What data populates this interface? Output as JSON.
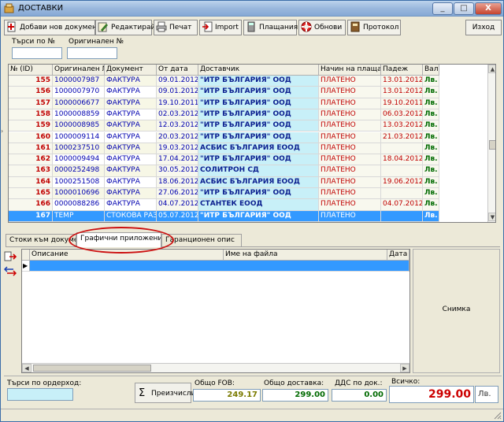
{
  "window": {
    "title": "ДОСТАВКИ",
    "min": "_",
    "max": "□",
    "close": "X"
  },
  "toolbar": {
    "add": "Добави нов документ",
    "edit": "Редактирай",
    "print": "Печат",
    "import": "Import",
    "payments": "Плащания",
    "refresh": "Обнови",
    "protocol": "Протокол",
    "exit": "Изход"
  },
  "search": {
    "by_number_label": "Търси по №",
    "by_original_label": "Оригинален №",
    "by_number_value": "",
    "by_original_value": ""
  },
  "grid": {
    "columns": [
      "№ (ID)",
      "Оригинален №",
      "Документ",
      "От дата",
      "Доставчик",
      "Начин на плащане",
      "Падеж",
      "Вал."
    ],
    "rows": [
      {
        "id": "155",
        "orig": "1000007987",
        "doc": "ФАКТУРА",
        "date": "09.01.2012",
        "supplier": "\"ИТР БЪЛГАРИЯ\" ООД",
        "pay": "ПЛАТЕНО",
        "due": "13.01.2012",
        "cur": "Лв."
      },
      {
        "id": "156",
        "orig": "1000007970",
        "doc": "ФАКТУРА",
        "date": "09.01.2012",
        "supplier": "\"ИТР БЪЛГАРИЯ\" ООД",
        "pay": "ПЛАТЕНО",
        "due": "13.01.2012",
        "cur": "Лв."
      },
      {
        "id": "157",
        "orig": "1000006677",
        "doc": "ФАКТУРА",
        "date": "19.10.2011",
        "supplier": "\"ИТР БЪЛГАРИЯ\" ООД",
        "pay": "ПЛАТЕНО",
        "due": "19.10.2011",
        "cur": "Лв."
      },
      {
        "id": "158",
        "orig": "1000008859",
        "doc": "ФАКТУРА",
        "date": "02.03.2012",
        "supplier": "\"ИТР БЪЛГАРИЯ\" ООД",
        "pay": "ПЛАТЕНО",
        "due": "06.03.2012",
        "cur": "Лв."
      },
      {
        "id": "159",
        "orig": "1000008985",
        "doc": "ФАКТУРА",
        "date": "12.03.2012",
        "supplier": "\"ИТР БЪЛГАРИЯ\" ООД",
        "pay": "ПЛАТЕНО",
        "due": "13.03.2012",
        "cur": "Лв."
      },
      {
        "id": "160",
        "orig": "1000009114",
        "doc": "ФАКТУРА",
        "date": "20.03.2012",
        "supplier": "\"ИТР БЪЛГАРИЯ\" ООД",
        "pay": "ПЛАТЕНО",
        "due": "21.03.2012",
        "cur": "Лв."
      },
      {
        "id": "161",
        "orig": "1000237510",
        "doc": "ФАКТУРА",
        "date": "19.03.2012",
        "supplier": "АСБИС БЪЛГАРИЯ ЕООД",
        "pay": "ПЛАТЕНО",
        "due": "",
        "cur": "Лв."
      },
      {
        "id": "162",
        "orig": "1000009494",
        "doc": "ФАКТУРА",
        "date": "17.04.2012",
        "supplier": "\"ИТР БЪЛГАРИЯ\" ООД",
        "pay": "ПЛАТЕНО",
        "due": "18.04.2012",
        "cur": "Лв."
      },
      {
        "id": "163",
        "orig": "0000252498",
        "doc": "ФАКТУРА",
        "date": "30.05.2012",
        "supplier": "СОЛИТРОН СД",
        "pay": "ПЛАТЕНО",
        "due": "",
        "cur": "Лв."
      },
      {
        "id": "164",
        "orig": "1000251508",
        "doc": "ФАКТУРА",
        "date": "18.06.2012",
        "supplier": "АСБИС БЪЛГАРИЯ ЕООД",
        "pay": "ПЛАТЕНО",
        "due": "19.06.2012",
        "cur": "Лв."
      },
      {
        "id": "165",
        "orig": "1000010696",
        "doc": "ФАКТУРА",
        "date": "27.06.2012",
        "supplier": "\"ИТР БЪЛГАРИЯ\" ООД",
        "pay": "ПЛАТЕНО",
        "due": "",
        "cur": "Лв."
      },
      {
        "id": "166",
        "orig": "0000088286",
        "doc": "ФАКТУРА",
        "date": "04.07.2012",
        "supplier": "СТАНТЕК ЕООД",
        "pay": "ПЛАТЕНО",
        "due": "04.07.2012",
        "cur": "Лв."
      },
      {
        "id": "167",
        "orig": "TEMP",
        "doc": "СТОКОВА РАЗП",
        "date": "05.07.2012",
        "supplier": "\"ИТР БЪЛГАРИЯ\" ООД",
        "pay": "ПЛАТЕНО",
        "due": "",
        "cur": "Лв.",
        "selected": true
      }
    ]
  },
  "tabs": [
    "Стоки към документа",
    "Графични приложения",
    "Гаранционен опис"
  ],
  "attachments": {
    "columns": [
      "Описание",
      "Име на файла",
      "Дата"
    ],
    "photo_label": "Снимка"
  },
  "footer": {
    "order_search_label": "Търси по ордерход:",
    "recalc_label": "Преизчисли",
    "fob_label": "Общо FOB:",
    "fob_value": "249.17",
    "delivery_label": "Общо доставка:",
    "delivery_value": "299.00",
    "vat_label": "ДДС по док.:",
    "vat_value": "0.00",
    "total_label": "Всичко:",
    "total_value": "299.00",
    "total_currency": "Лв."
  },
  "colors": {
    "selected_row": "#3399ff",
    "paid": "#c00000",
    "supplier_bg": "#c8f0f8",
    "accent_red": "#cc1111"
  }
}
